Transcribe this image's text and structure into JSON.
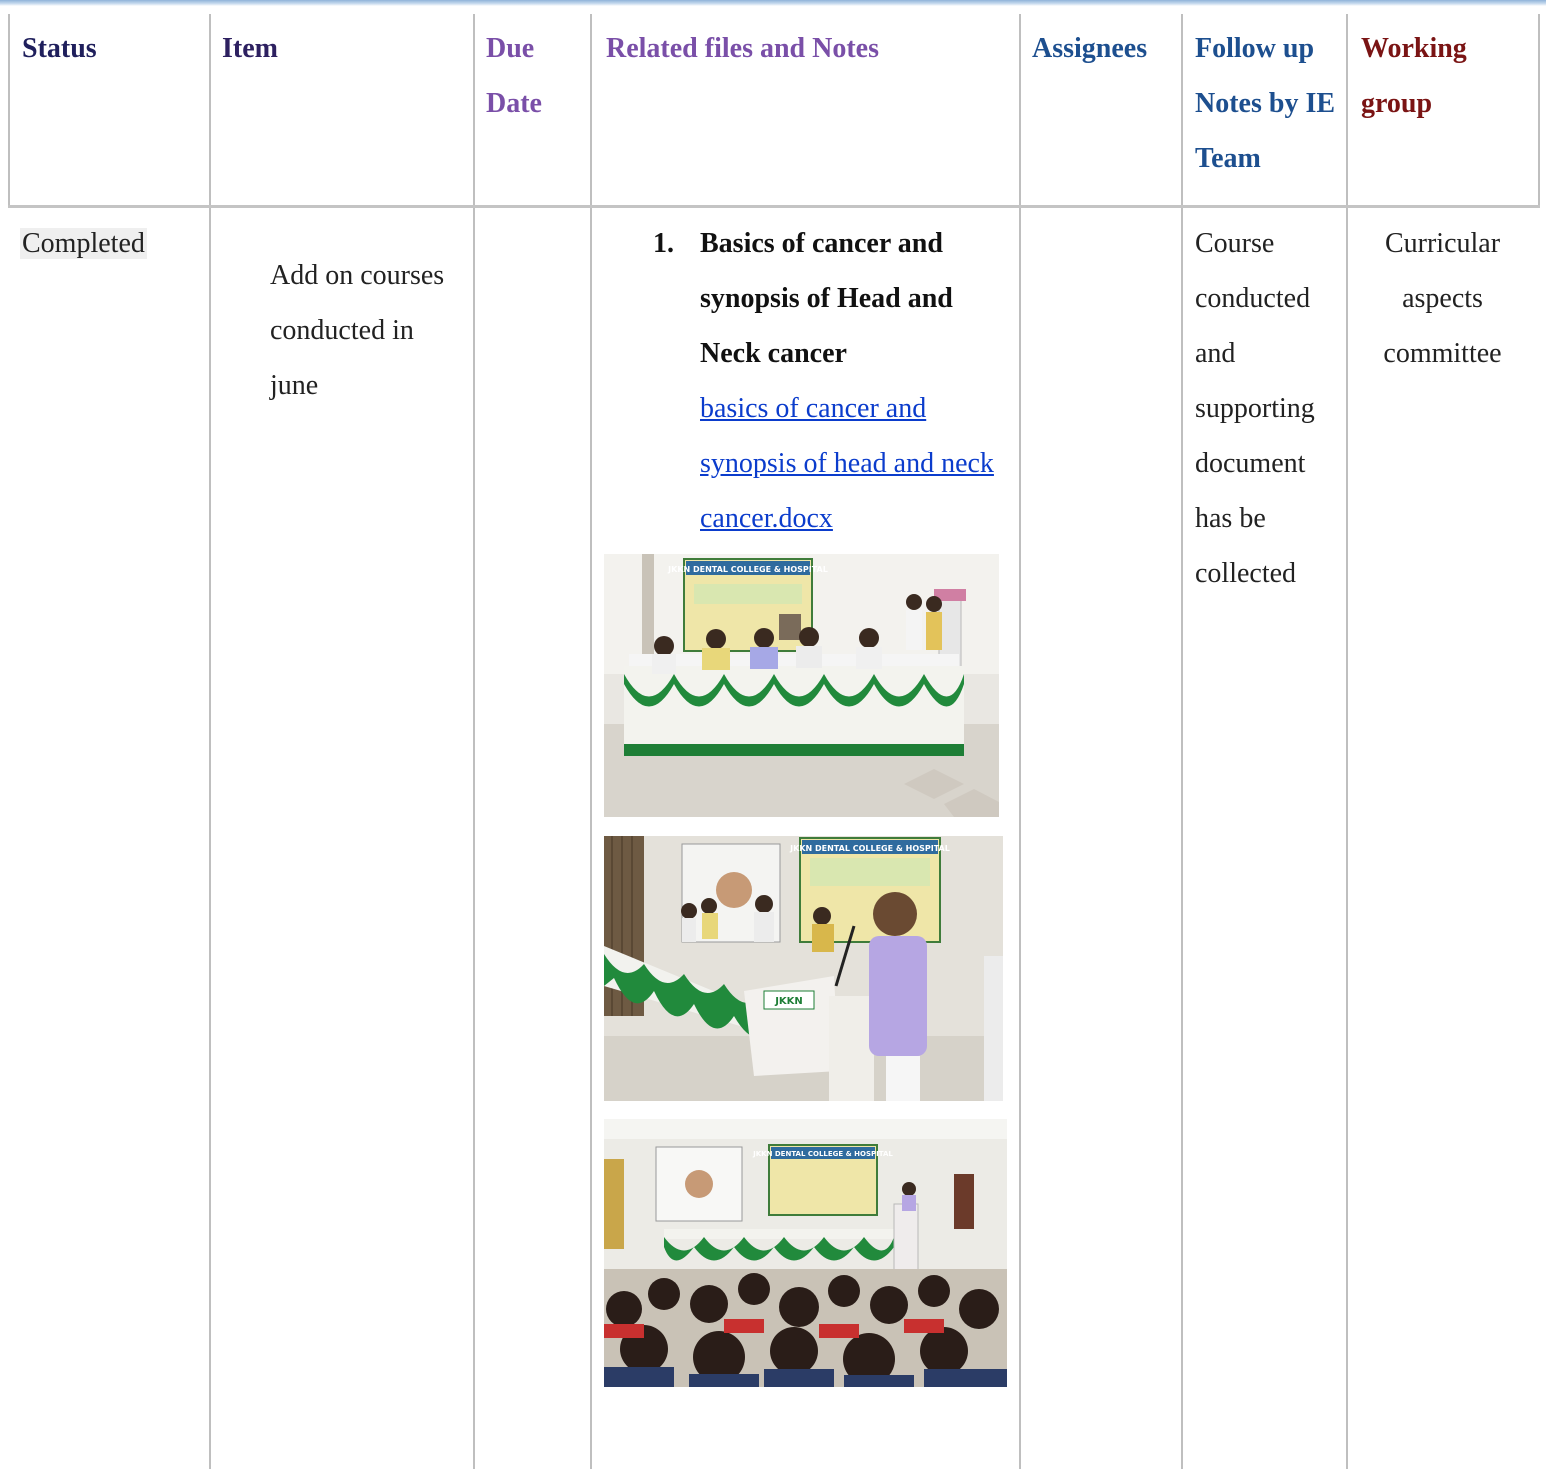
{
  "headers": {
    "status": "Status",
    "item": "Item",
    "due_date": "Due Date",
    "related": "Related files and Notes",
    "assignees": "Assignees",
    "follow_up": "Follow up Notes by IE Team",
    "working_group": "Working group"
  },
  "row": {
    "status": "Completed",
    "item": "Add on courses conducted in june",
    "due_date": "",
    "notes_number": "1.",
    "notes_title": "Basics of cancer and synopsis of Head and Neck cancer",
    "notes_link": "basics of cancer and synopsis of head and neck cancer.docx",
    "assignees": "",
    "follow_up": "Course conducted and supporting document has be collected",
    "working_group": "Curricular aspects committee"
  },
  "photos": [
    {
      "name": "photo-dais-panel",
      "banner": "JKKN DENTAL COLLEGE & HOSPITAL"
    },
    {
      "name": "photo-speaker-podium",
      "banner": "JKKN DENTAL COLLEGE & HOSPITAL",
      "podium": "JKKN"
    },
    {
      "name": "photo-audience",
      "banner": "JKKN DENTAL COLLEGE & HOSPITAL"
    }
  ],
  "colors": {
    "header_status": "#1f1f5c",
    "header_purple": "#7a4fa8",
    "header_blue": "#1d4f8f",
    "header_maroon": "#7a1414",
    "link": "#0b3ccc",
    "status_highlight": "#efefef"
  }
}
